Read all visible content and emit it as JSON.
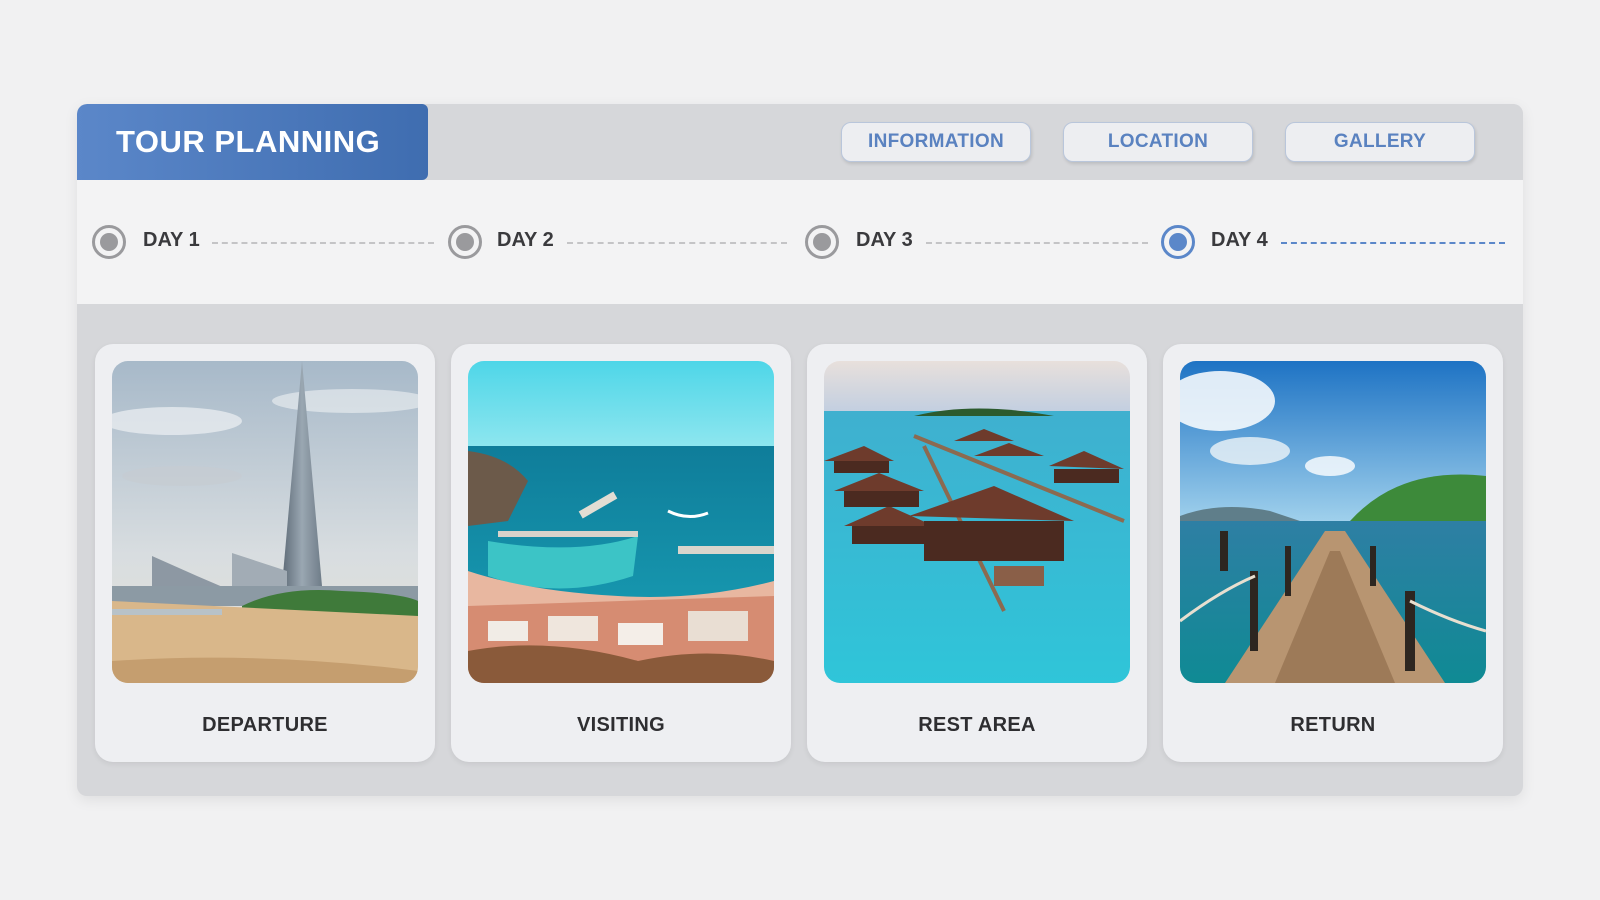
{
  "header": {
    "title": "TOUR PLANNING",
    "nav": [
      {
        "label": "INFORMATION"
      },
      {
        "label": "LOCATION"
      },
      {
        "label": "GALLERY"
      }
    ]
  },
  "timeline": {
    "days": [
      {
        "label": "DAY 1",
        "selected": false
      },
      {
        "label": "DAY 2",
        "selected": false
      },
      {
        "label": "DAY 3",
        "selected": false
      },
      {
        "label": "DAY 4",
        "selected": true
      }
    ]
  },
  "cards": [
    {
      "label": "DEPARTURE",
      "image": "skyscraper-beach-photo"
    },
    {
      "label": "VISITING",
      "image": "coastal-marina-photo"
    },
    {
      "label": "REST AREA",
      "image": "overwater-bungalows-photo"
    },
    {
      "label": "RETURN",
      "image": "wooden-pier-photo"
    }
  ],
  "colors": {
    "accent": "#5b87c9",
    "panel": "#d6d7da",
    "timeline_bg": "#f3f3f4",
    "inactive_radio": "#9a9a9d"
  }
}
